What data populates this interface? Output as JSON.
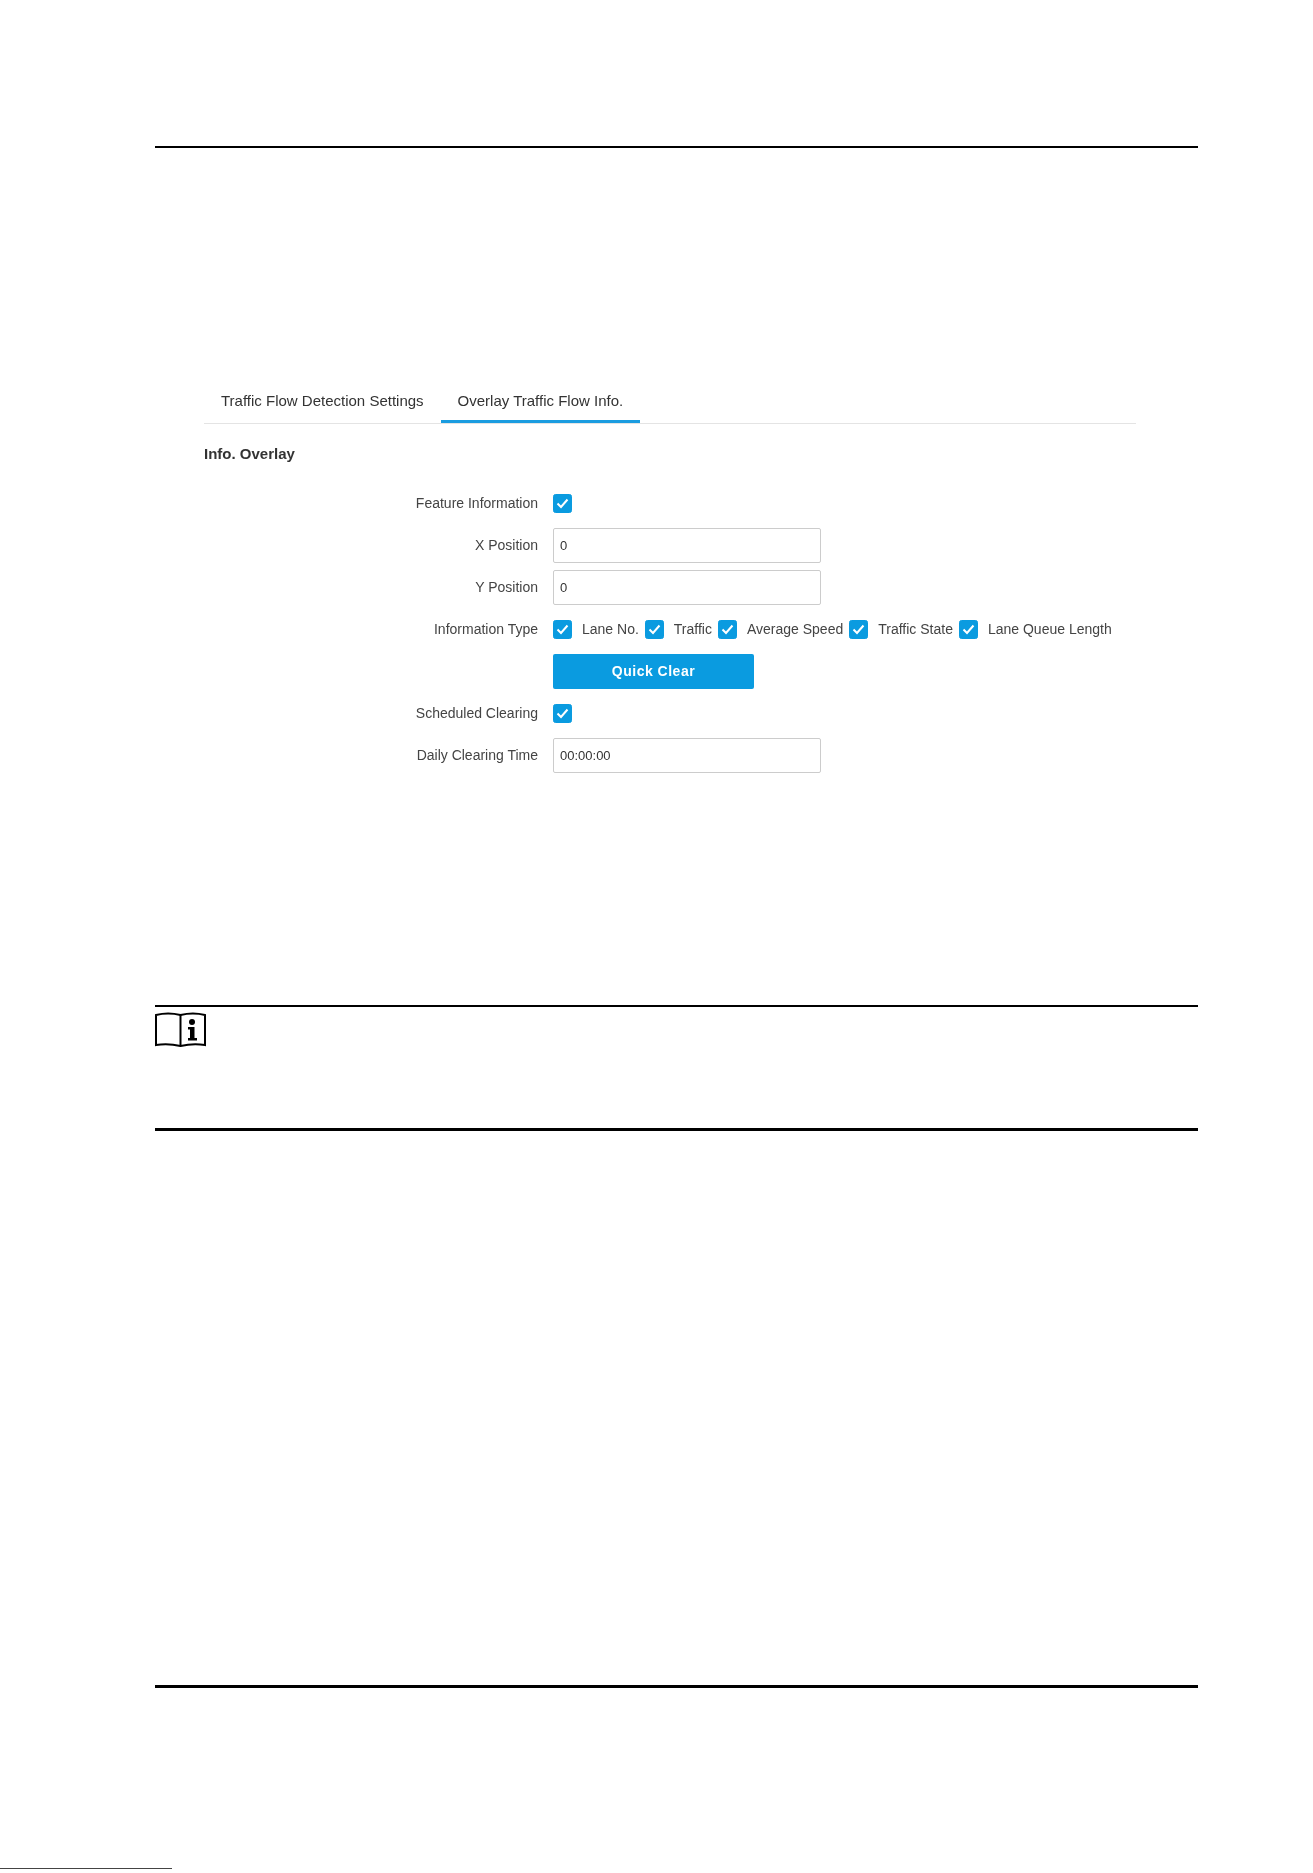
{
  "tabs": [
    {
      "label": "Traffic Flow Detection Settings",
      "selected": false
    },
    {
      "label": "Overlay Traffic Flow Info.",
      "selected": true
    }
  ],
  "section_title": "Info. Overlay",
  "form": {
    "rows": [
      {
        "kind": "checkbox",
        "label": "Feature Information",
        "checked": true
      },
      {
        "kind": "text",
        "label": "X Position",
        "value": "0"
      },
      {
        "kind": "text",
        "label": "Y Position",
        "value": "0"
      },
      {
        "kind": "checkgroup",
        "label": "Information Type",
        "options": [
          {
            "label": "Lane No.",
            "checked": true
          },
          {
            "label": "Traffic",
            "checked": true
          },
          {
            "label": "Average Speed",
            "checked": true
          },
          {
            "label": "Traffic State",
            "checked": true
          },
          {
            "label": "Lane Queue Length",
            "checked": true
          }
        ]
      },
      {
        "kind": "button",
        "label": "Quick Clear"
      },
      {
        "kind": "checkbox",
        "label": "Scheduled Clearing",
        "checked": true
      },
      {
        "kind": "text",
        "label": "Daily Clearing Time",
        "value": "00:00:00"
      }
    ]
  }
}
